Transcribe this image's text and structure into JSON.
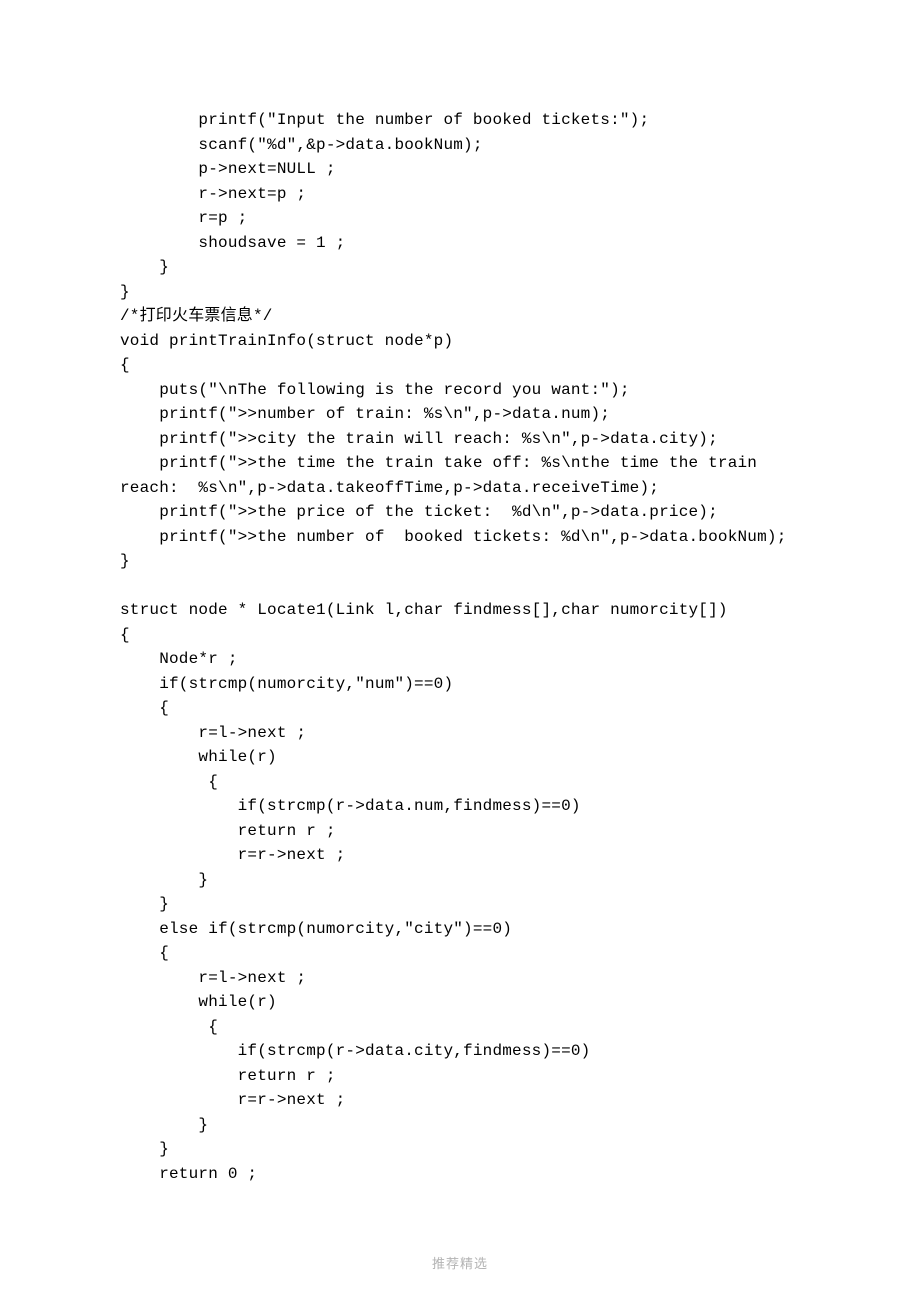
{
  "code": {
    "l01": "        printf(\"Input the number of booked tickets:\");",
    "l02": "        scanf(\"%d\",&p->data.bookNum);",
    "l03": "        p->next=NULL ;",
    "l04": "        r->next=p ;",
    "l05": "        r=p ;",
    "l06": "        shoudsave = 1 ;",
    "l07": "    }",
    "l08": "}",
    "l09": "/*打印火车票信息*/",
    "l10": "void printTrainInfo(struct node*p)",
    "l11": "{",
    "l12": "    puts(\"\\nThe following is the record you want:\");",
    "l13": "    printf(\">>number of train: %s\\n\",p->data.num);",
    "l14": "    printf(\">>city the train will reach: %s\\n\",p->data.city);",
    "l15": "    printf(\">>the time the train take off: %s\\nthe time the train",
    "l16": "reach:  %s\\n\",p->data.takeoffTime,p->data.receiveTime);",
    "l17": "    printf(\">>the price of the ticket:  %d\\n\",p->data.price);",
    "l18": "    printf(\">>the number of  booked tickets: %d\\n\",p->data.bookNum);",
    "l19": "}",
    "l20": "",
    "l21": "struct node * Locate1(Link l,char findmess[],char numorcity[])",
    "l22": "{",
    "l23": "    Node*r ;",
    "l24": "    if(strcmp(numorcity,\"num\")==0)",
    "l25": "    {",
    "l26": "        r=l->next ;",
    "l27": "        while(r)",
    "l28": "         {",
    "l29": "            if(strcmp(r->data.num,findmess)==0)",
    "l30": "            return r ;",
    "l31": "            r=r->next ;",
    "l32": "        }",
    "l33": "    }",
    "l34": "    else if(strcmp(numorcity,\"city\")==0)",
    "l35": "    {",
    "l36": "        r=l->next ;",
    "l37": "        while(r)",
    "l38": "         {",
    "l39": "            if(strcmp(r->data.city,findmess)==0)",
    "l40": "            return r ;",
    "l41": "            r=r->next ;",
    "l42": "        }",
    "l43": "    }",
    "l44": "    return 0 ;"
  },
  "footer": "推荐精选"
}
